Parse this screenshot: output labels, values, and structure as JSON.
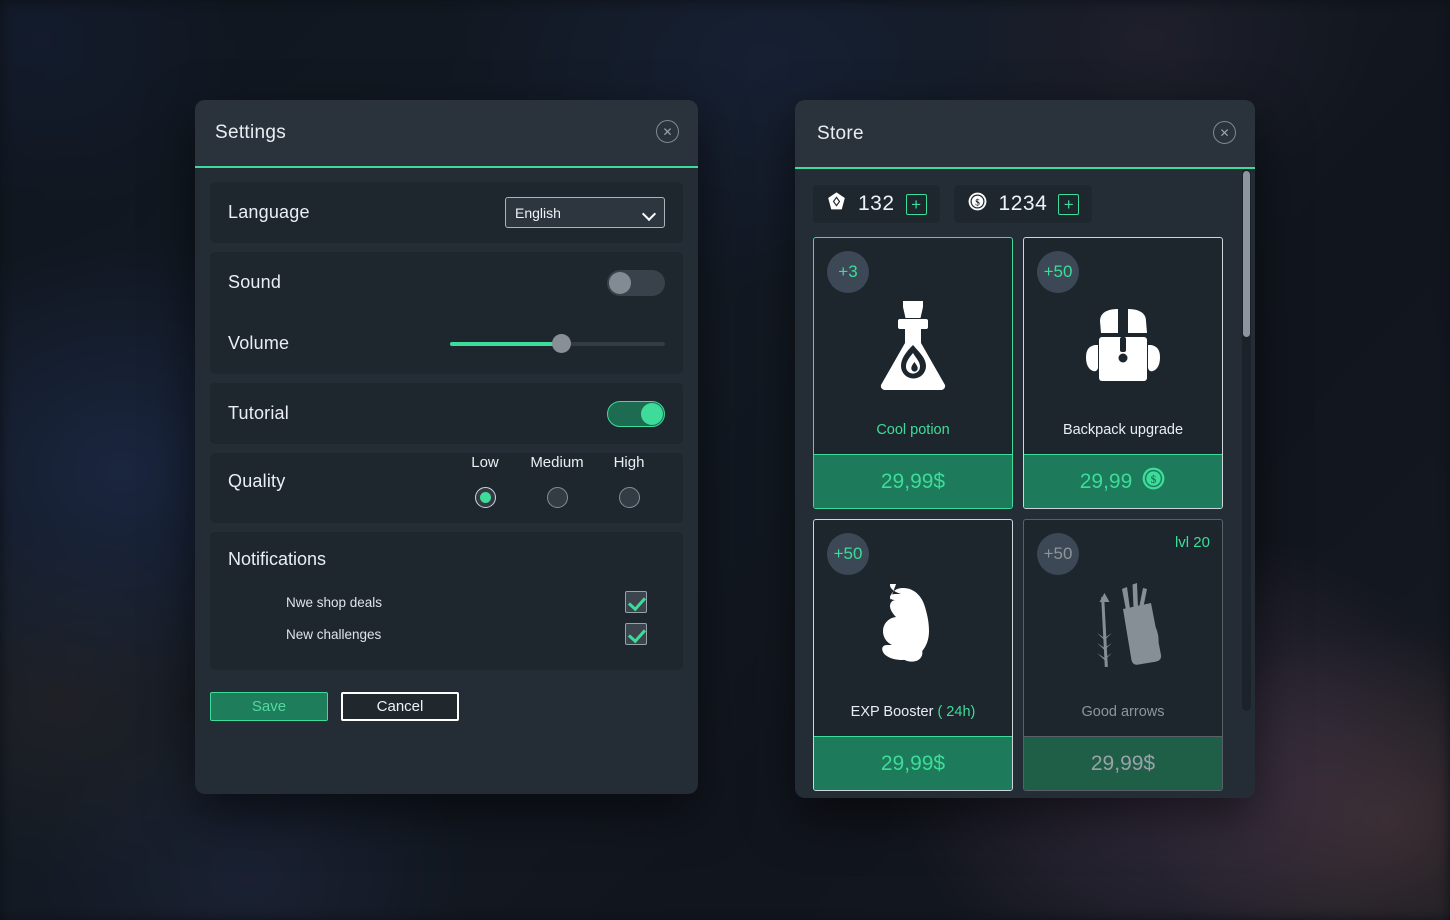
{
  "settings": {
    "title": "Settings",
    "close_icon": "close-icon",
    "language": {
      "label": "Language",
      "value": "English"
    },
    "sound": {
      "label": "Sound",
      "state": "off"
    },
    "volume": {
      "label": "Volume",
      "percent": 52
    },
    "tutorial": {
      "label": "Tutorial",
      "state": "on"
    },
    "quality": {
      "label": "Quality",
      "options": [
        {
          "label": "Low",
          "selected": true
        },
        {
          "label": "Medium",
          "selected": false
        },
        {
          "label": "High",
          "selected": false
        }
      ]
    },
    "notifications": {
      "title": "Notifications",
      "items": [
        {
          "label": "Nwe shop deals",
          "checked": true
        },
        {
          "label": "New challenges",
          "checked": true
        }
      ]
    },
    "save_label": "Save",
    "cancel_label": "Cancel"
  },
  "store": {
    "title": "Store",
    "close_icon": "close-icon",
    "currencies": [
      {
        "icon": "gem-icon",
        "amount": "132",
        "plus": "+"
      },
      {
        "icon": "coin-icon",
        "amount": "1234",
        "plus": "+"
      }
    ],
    "items": [
      {
        "badge": "+3",
        "icon": "potion-icon",
        "name": "Cool potion",
        "price": "29,99$",
        "price_icon": "",
        "style": "accent",
        "locked": false,
        "level_req": ""
      },
      {
        "badge": "+50",
        "icon": "backpack-icon",
        "name": "Backpack  upgrade",
        "price": "29,99",
        "price_icon": "coin-icon",
        "style": "normal",
        "locked": false,
        "level_req": ""
      },
      {
        "badge": "+50",
        "icon": "muscle-icon",
        "name": "EXP Booster",
        "name_sub": "( 24h)",
        "price": "29,99$",
        "price_icon": "",
        "style": "normal",
        "locked": false,
        "level_req": ""
      },
      {
        "badge": "+50",
        "icon": "quiver-icon",
        "name": "Good arrows",
        "price": "29,99$",
        "price_icon": "",
        "style": "locked",
        "locked": true,
        "level_req": "lvl 20"
      }
    ]
  },
  "colors": {
    "accent_green": "#3ddc9a",
    "panel_bg": "#242d35",
    "group_bg": "#1f272e",
    "price_green": "#1d7a5a",
    "text": "#e8eef3",
    "muted": "#8d959c"
  }
}
